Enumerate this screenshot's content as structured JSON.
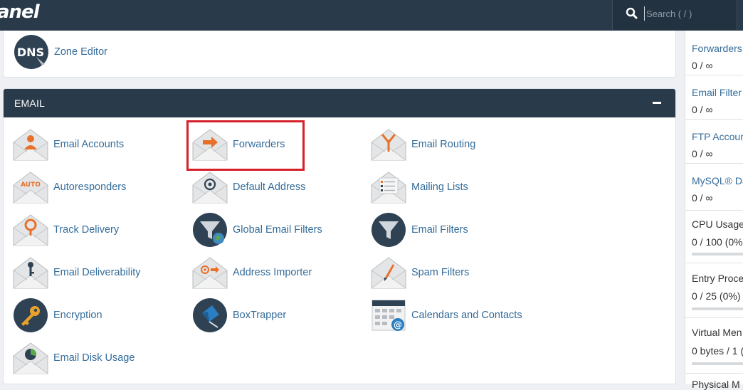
{
  "header": {
    "logo_text": "anel",
    "search": {
      "placeholder": "Search ( / )"
    }
  },
  "domains_section": {
    "items": [
      {
        "label": "Zone Editor",
        "icon": "dns-icon"
      }
    ]
  },
  "email_section": {
    "title": "EMAIL",
    "collapse_label": "collapse",
    "items": [
      {
        "label": "Email Accounts",
        "icon": "email-accounts-icon"
      },
      {
        "label": "Forwarders",
        "icon": "forwarders-icon"
      },
      {
        "label": "Email Routing",
        "icon": "email-routing-icon"
      },
      {
        "label": "Autoresponders",
        "icon": "autoresponders-icon",
        "icon_text": "AUTO"
      },
      {
        "label": "Default Address",
        "icon": "default-address-icon"
      },
      {
        "label": "Mailing Lists",
        "icon": "mailing-lists-icon"
      },
      {
        "label": "Track Delivery",
        "icon": "track-delivery-icon"
      },
      {
        "label": "Global Email Filters",
        "icon": "global-filter-icon"
      },
      {
        "label": "Email Filters",
        "icon": "email-filter-icon"
      },
      {
        "label": "Email Deliverability",
        "icon": "email-deliverability-icon"
      },
      {
        "label": "Address Importer",
        "icon": "address-importer-icon"
      },
      {
        "label": "Spam Filters",
        "icon": "spam-filters-icon"
      },
      {
        "label": "Encryption",
        "icon": "encryption-key-icon"
      },
      {
        "label": "BoxTrapper",
        "icon": "boxtrapper-icon"
      },
      {
        "label": "Calendars and Contacts",
        "icon": "calendar-icon"
      },
      {
        "label": "Email Disk Usage",
        "icon": "email-disk-usage-icon"
      }
    ],
    "highlighted_item": "Forwarders"
  },
  "stats": [
    {
      "label": "Forwarders",
      "value": "0 / ∞",
      "link": true
    },
    {
      "label": "Email Filter",
      "value": "0 / ∞",
      "link": true
    },
    {
      "label": "FTP Accoun",
      "value": "0 / ∞",
      "link": true
    },
    {
      "label": "MySQL® Da",
      "value": "0 / ∞",
      "link": true
    },
    {
      "label": "CPU Usage",
      "value": "0 / 100   (0%",
      "link": false
    },
    {
      "label": "Entry Proce",
      "value": "0 / 25   (0%)",
      "link": false
    },
    {
      "label": "Virtual Men",
      "value": "0 bytes / 1 (",
      "link": false
    },
    {
      "label": "Physical M",
      "value": "",
      "link": false
    }
  ],
  "colors": {
    "header_bg": "#293a4a",
    "link": "#346c9a",
    "icon_orange": "#e8702a",
    "highlight": "#d6202a"
  }
}
